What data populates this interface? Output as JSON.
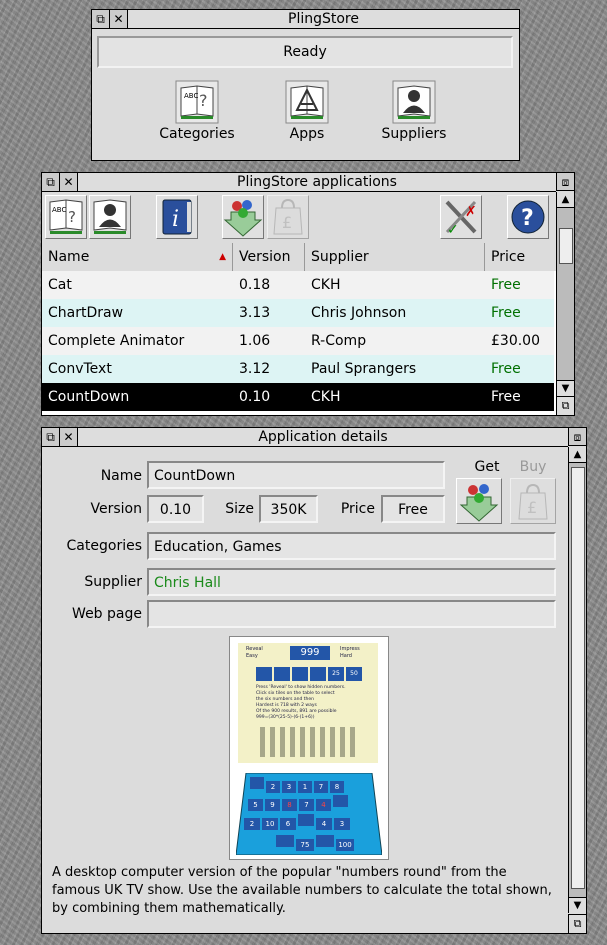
{
  "main_window": {
    "title": "PlingStore",
    "status": "Ready",
    "buttons": [
      {
        "label": "Categories",
        "icon": "categories-book-icon"
      },
      {
        "label": "Apps",
        "icon": "apps-book-icon"
      },
      {
        "label": "Suppliers",
        "icon": "suppliers-book-icon"
      }
    ]
  },
  "apps_window": {
    "title": "PlingStore applications",
    "toolbar_icons": [
      "categories-icon",
      "suppliers-icon",
      "info-icon",
      "get-icon",
      "buy-icon",
      "tools-icon",
      "help-icon"
    ],
    "columns": [
      "Name",
      "Version",
      "Supplier",
      "Price"
    ],
    "sort_indicator": "sort-descending-icon",
    "rows": [
      {
        "name": "Cat",
        "version": "0.18",
        "supplier": "CKH",
        "price": "Free"
      },
      {
        "name": "ChartDraw",
        "version": "3.13",
        "supplier": "Chris Johnson",
        "price": "Free"
      },
      {
        "name": "Complete Animator",
        "version": "1.06",
        "supplier": "R-Comp",
        "price": "£30.00"
      },
      {
        "name": "ConvText",
        "version": "3.12",
        "supplier": "Paul Sprangers",
        "price": "Free"
      },
      {
        "name": "CountDown",
        "version": "0.10",
        "supplier": "CKH",
        "price": "Free"
      }
    ],
    "selected_row": 4
  },
  "details_window": {
    "title": "Application details",
    "name_label": "Name",
    "name_value": "CountDown",
    "version_label": "Version",
    "version_value": "0.10",
    "size_label": "Size",
    "size_value": "350K",
    "price_label": "Price",
    "price_value": "Free",
    "get_label": "Get",
    "buy_label": "Buy",
    "categories_label": "Categories",
    "categories_value": "Education, Games",
    "supplier_label": "Supplier",
    "supplier_value": "Chris Hall",
    "webpage_label": "Web page",
    "webpage_value": "",
    "screenshot": {
      "target": "999",
      "small_left": "Reveal",
      "small_left2": "Easy",
      "small_right": "Impress",
      "small_right2": "Hard",
      "tiles": [
        "",
        "",
        "",
        "",
        "25",
        "50"
      ],
      "instructions": [
        "Press 'Reveal' to show hidden numbers.",
        "Click six tiles on the table to select",
        "the six numbers and then",
        "Hardest is 718 with 2 ways",
        "Of the 900 results, 891 are possible",
        "999=(30*(25-5)-(6-(1+6))"
      ],
      "grid_rows": [
        [
          "2",
          "3",
          "1",
          "7",
          "8"
        ],
        [
          "9",
          "8",
          "7",
          "4",
          ""
        ],
        [
          "10",
          "6",
          "",
          "4",
          "3"
        ],
        [
          "75",
          "",
          "100"
        ]
      ],
      "grid_first": [
        "",
        "5",
        "2",
        ""
      ]
    },
    "description": "A desktop computer version of the popular \"numbers round\" from the famous UK TV show.  Use the available numbers to calculate the total shown, by combining them mathematically."
  },
  "colors": {
    "free_price": "#007000",
    "supplier_link": "#1a8a1a",
    "row_alt": "#ddf4f4",
    "row_selected": "#000000"
  }
}
